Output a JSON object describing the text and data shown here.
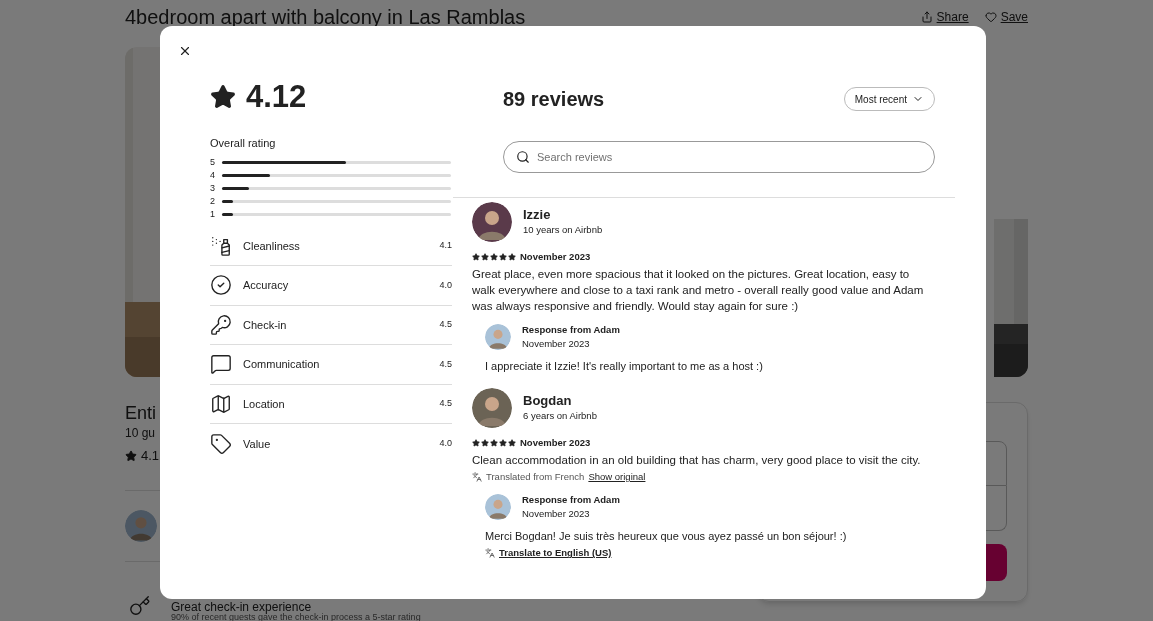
{
  "listing": {
    "title": "4bedroom apart with balcony in Las Ramblas",
    "actions": [
      {
        "label": "Share",
        "kind": "share"
      },
      {
        "label": "Save",
        "kind": "save"
      }
    ],
    "type_partial": "Enti",
    "guests_partial": "10 gu",
    "rating_partial": "4.1",
    "highlight": {
      "title": "Great check-in experience",
      "text": "90% of recent guests gave the check-in process a 5-star rating"
    }
  },
  "modal": {
    "rating": "4.12",
    "overall_label": "Overall rating",
    "distribution": [
      {
        "label": "5",
        "level": 0.54
      },
      {
        "label": "4",
        "level": 0.21
      },
      {
        "label": "3",
        "level": 0.12
      },
      {
        "label": "2",
        "level": 0.05
      },
      {
        "label": "1",
        "level": 0.05
      }
    ],
    "categories": [
      {
        "name": "Cleanliness",
        "score": "4.1",
        "kind": "cleanliness"
      },
      {
        "name": "Accuracy",
        "score": "4.0",
        "kind": "accuracy"
      },
      {
        "name": "Check-in",
        "score": "4.5",
        "kind": "checkin"
      },
      {
        "name": "Communication",
        "score": "4.5",
        "kind": "communication"
      },
      {
        "name": "Location",
        "score": "4.5",
        "kind": "location"
      },
      {
        "name": "Value",
        "score": "4.0",
        "kind": "value"
      }
    ],
    "review_count": "89 reviews",
    "sort": "Most recent",
    "search_placeholder": "Search reviews",
    "reviews": [
      {
        "name": "Izzie",
        "tenure": "10 years on Airbnb",
        "stars": 5,
        "date": "November 2023",
        "text": "Great place, even more spacious that it looked on the pictures. Great location, easy to walk everywhere and close to a taxi rank and metro - overall really good value and Adam was always responsive and friendly. Would stay again for sure :)",
        "response": {
          "title": "Response from Adam",
          "date": "November 2023",
          "text": "I appreciate it Izzie! It's really important to me as a host :)"
        }
      },
      {
        "name": "Bogdan",
        "tenure": "6 years on Airbnb",
        "stars": 5,
        "date": "November 2023",
        "text": "Clean accommodation in an old building that has charm, very good place to visit the city.",
        "translation": {
          "note": "Translated from French",
          "link": "Show original"
        },
        "response": {
          "title": "Response from Adam",
          "date": "November 2023",
          "text": "Merci Bogdan! Je suis très heureux que vous ayez passé un bon séjour! :)",
          "translate_link": "Translate to English (US)"
        }
      }
    ]
  }
}
